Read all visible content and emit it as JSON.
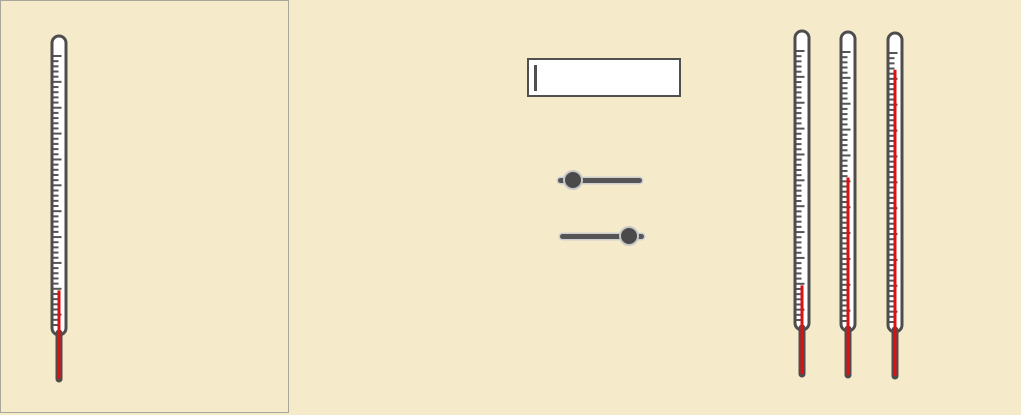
{
  "colors": {
    "background": "#f5ebcb",
    "outline": "#4d4d4d",
    "mercury": "#dd1111",
    "tick": "#555555"
  },
  "level_input": {
    "value": ""
  },
  "main_thermometer": {
    "fill_fraction": 0.16
  },
  "sliders": [
    {
      "name": "slider-1",
      "value_fraction": 0.18
    },
    {
      "name": "slider-2",
      "value_fraction": 0.82
    }
  ],
  "small_thermometers": [
    {
      "name": "thermometer-1",
      "fill_fraction": 0.16
    },
    {
      "name": "thermometer-2",
      "fill_fraction": 0.55
    },
    {
      "name": "thermometer-3",
      "fill_fraction": 0.94
    }
  ]
}
